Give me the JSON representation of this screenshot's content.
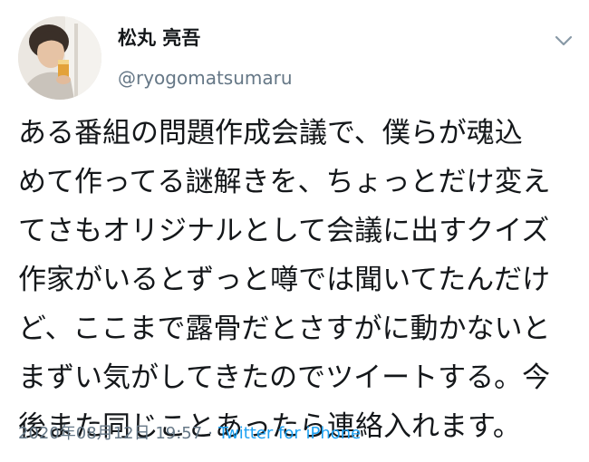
{
  "author": {
    "display_name": "松丸 亮吾",
    "handle": "@ryogomatsumaru",
    "avatar_icon": "profile-photo-icon"
  },
  "menu": {
    "icon": "chevron-down-icon"
  },
  "tweet": {
    "lines": [
      "ある番組の問題作成会議で、僕らが魂込",
      "めて作ってる謎解きを、ちょっとだけ変え",
      "てさもオリジナルとして会議に出すクイズ",
      "作家がいるとずっと噂では聞いてたんだけ",
      "ど、ここまで露骨だとさすがに動かないと",
      "まずい気がしてきたのでツイートする。今",
      "後また同じことあったら連絡入れます。"
    ]
  },
  "meta": {
    "timestamp": "2020年08月12日 19:57",
    "separator": "·",
    "source": "Twitter for iPhone"
  },
  "colors": {
    "text": "#14171a",
    "secondary": "#657786",
    "link": "#1da1f2"
  }
}
